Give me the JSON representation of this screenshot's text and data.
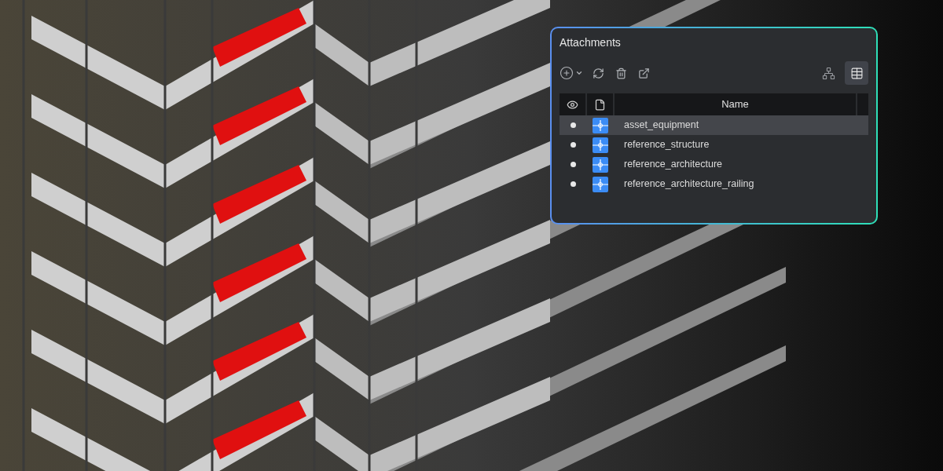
{
  "panel": {
    "title": "Attachments",
    "view_buttons": [
      {
        "kind": "tree",
        "selected": false
      },
      {
        "kind": "table",
        "selected": true
      }
    ],
    "table": {
      "name_column": "Name",
      "rows": [
        {
          "name": "asset_equipment",
          "selected": true
        },
        {
          "name": "reference_structure",
          "selected": false
        },
        {
          "name": "reference_architecture",
          "selected": false
        },
        {
          "name": "reference_architecture_railing",
          "selected": false
        }
      ]
    }
  }
}
